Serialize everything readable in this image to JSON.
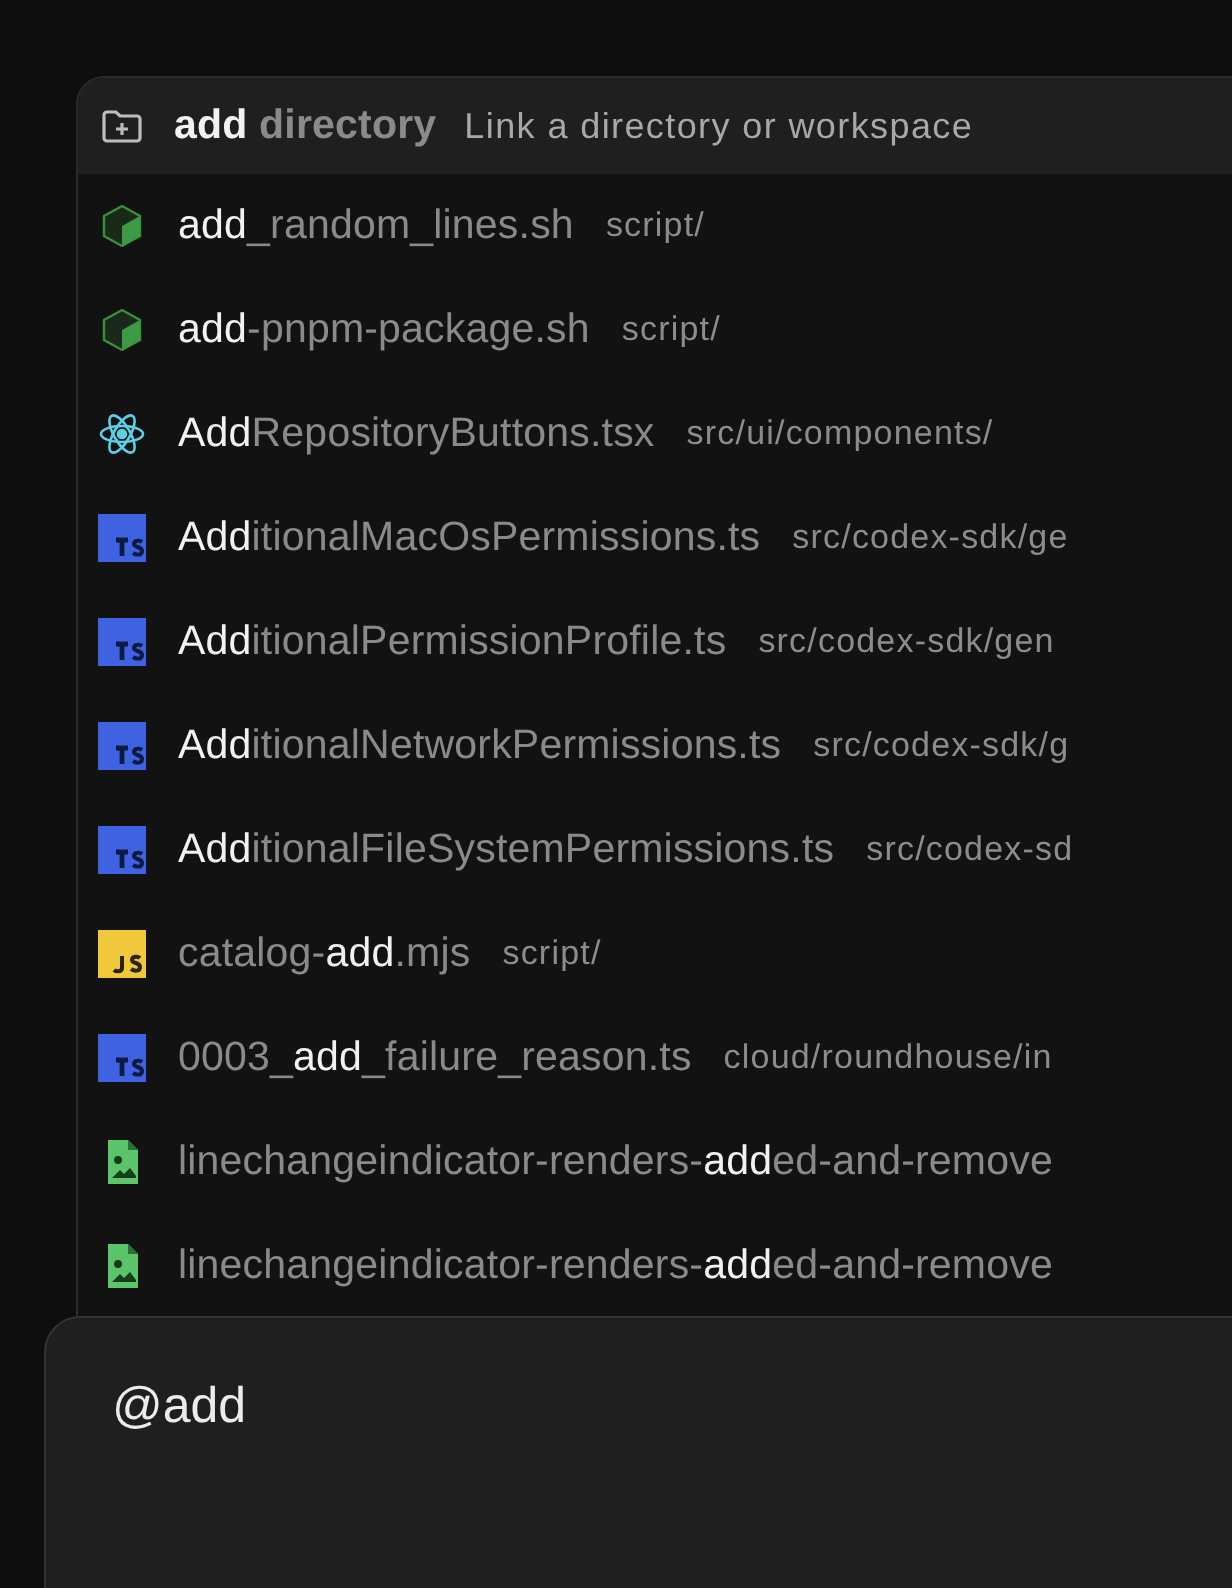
{
  "header": {
    "kind": "directory",
    "name": [
      {
        "text": "add",
        "match": true
      },
      {
        "text": " directory",
        "match": false
      }
    ],
    "description": "Link a directory or workspace"
  },
  "results": [
    {
      "kind": "sh",
      "name": [
        {
          "text": "add",
          "match": true
        },
        {
          "text": "_random_lines.sh",
          "match": false
        }
      ],
      "path": "script/"
    },
    {
      "kind": "sh",
      "name": [
        {
          "text": "add",
          "match": true
        },
        {
          "text": "-pnpm-package.sh",
          "match": false
        }
      ],
      "path": "script/"
    },
    {
      "kind": "tsx",
      "name": [
        {
          "text": "Add",
          "match": true
        },
        {
          "text": "RepositoryButtons.tsx",
          "match": false
        }
      ],
      "path": "src/ui/components/"
    },
    {
      "kind": "ts",
      "name": [
        {
          "text": "Add",
          "match": true
        },
        {
          "text": "itionalMacOsPermissions.ts",
          "match": false
        }
      ],
      "path": "src/codex-sdk/ge"
    },
    {
      "kind": "ts",
      "name": [
        {
          "text": "Add",
          "match": true
        },
        {
          "text": "itionalPermissionProfile.ts",
          "match": false
        }
      ],
      "path": "src/codex-sdk/gen"
    },
    {
      "kind": "ts",
      "name": [
        {
          "text": "Add",
          "match": true
        },
        {
          "text": "itionalNetworkPermissions.ts",
          "match": false
        }
      ],
      "path": "src/codex-sdk/g"
    },
    {
      "kind": "ts",
      "name": [
        {
          "text": "Add",
          "match": true
        },
        {
          "text": "itionalFileSystemPermissions.ts",
          "match": false
        }
      ],
      "path": "src/codex-sd"
    },
    {
      "kind": "mjs",
      "name": [
        {
          "text": "catalog-",
          "match": false
        },
        {
          "text": "add",
          "match": true
        },
        {
          "text": ".mjs",
          "match": false
        }
      ],
      "path": "script/"
    },
    {
      "kind": "ts",
      "name": [
        {
          "text": "0003_",
          "match": false
        },
        {
          "text": "add",
          "match": true
        },
        {
          "text": "_failure_reason.ts",
          "match": false
        }
      ],
      "path": "cloud/roundhouse/in"
    },
    {
      "kind": "image",
      "name": [
        {
          "text": "linechangeindicator-renders-",
          "match": false
        },
        {
          "text": "add",
          "match": true
        },
        {
          "text": "ed-and-remove",
          "match": false
        }
      ]
    },
    {
      "kind": "image",
      "name": [
        {
          "text": "linechangeindicator-renders-",
          "match": false
        },
        {
          "text": "add",
          "match": true
        },
        {
          "text": "ed-and-remove",
          "match": false
        }
      ]
    }
  ],
  "composer": {
    "value": "@add"
  }
}
